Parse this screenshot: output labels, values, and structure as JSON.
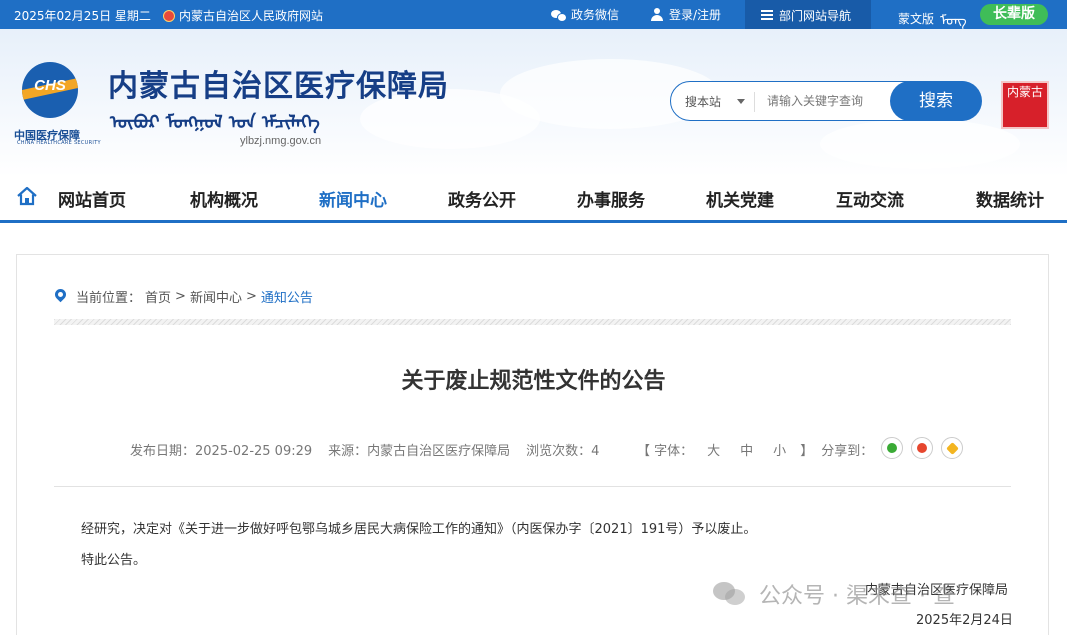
{
  "topbar": {
    "date": "2025年02月25日 星期二",
    "gov_site": "内蒙古自治区人民政府网站",
    "wechat": "政务微信",
    "login": "登录/注册",
    "dept_nav": "部门网站导航",
    "mongolian_label": "蒙文版",
    "mongolian_script": "ᠮᠣᠩ",
    "elder_mode": "长辈版"
  },
  "header": {
    "logo_text": "CHS",
    "logo_cn": "中国医疗保障",
    "logo_en": "CHINA HEALTHCARE SECURITY",
    "title": "内蒙古自治区医疗保障局",
    "title_mongolian": "ᠥᠪᠥᠷ ᠮᠣᠩᠭᠣᠯ ᠤᠨ ᠡᠮᠴᠢᠯᠡᠭᠡ",
    "url": "ylbzj.nmg.gov.cn",
    "search_scope": "搜本站",
    "search_placeholder": "请输入关键字查询",
    "search_button": "搜索",
    "seal_text": "内蒙古"
  },
  "nav": {
    "items": [
      "网站首页",
      "机构概况",
      "新闻中心",
      "政务公开",
      "办事服务",
      "机关党建",
      "互动交流",
      "数据统计"
    ],
    "active": "新闻中心"
  },
  "breadcrumb": {
    "label": "当前位置：",
    "home": "首页",
    "sep": ">",
    "news": "新闻中心",
    "current": "通知公告"
  },
  "article": {
    "title": "关于废止规范性文件的公告",
    "publish_date": "发布日期：2025-02-25 09:29",
    "source": "来源：内蒙古自治区医疗保障局",
    "views": "浏览次数：4",
    "font_label": "【 字体：",
    "font_large": "大",
    "font_medium": "中",
    "font_small": "小",
    "font_close": "】",
    "share_label": "分享到：",
    "paragraph1": "经研究，决定对《关于进一步做好呼包鄂乌城乡居民大病保险工作的通知》（内医保办字〔2021〕191号）予以废止。",
    "paragraph2": "特此公告。",
    "signature": "内蒙古自治区医疗保障局",
    "sign_date": "2025年2月24日"
  },
  "watermark": {
    "text": "公众号 · 渠末查 · 查"
  }
}
